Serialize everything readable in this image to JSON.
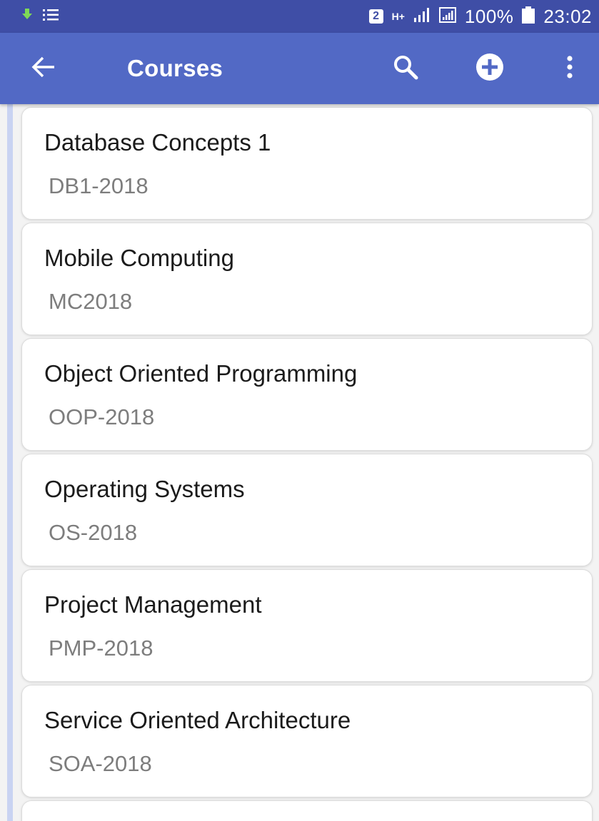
{
  "status_bar": {
    "sim_slot": "2",
    "network_type": "H+",
    "battery_percent": "100%",
    "time": "23:02",
    "icons": [
      "download-icon",
      "notification-list-icon",
      "sim-2-icon",
      "data-hplus-icon",
      "signal-icon",
      "signal-sim2-icon",
      "battery-icon"
    ]
  },
  "app_bar": {
    "title": "Courses",
    "background_color": "#5269c5",
    "icons": [
      "arrow-back-icon",
      "search-icon",
      "add-circle-icon",
      "more-vert-icon"
    ]
  },
  "courses": [
    {
      "name": "Database Concepts 1",
      "code": "DB1-2018"
    },
    {
      "name": "Mobile Computing",
      "code": "MC2018"
    },
    {
      "name": "Object Oriented Programming",
      "code": "OOP-2018"
    },
    {
      "name": "Operating Systems",
      "code": "OS-2018"
    },
    {
      "name": "Project Management",
      "code": "PMP-2018"
    },
    {
      "name": "Service Oriented Architecture",
      "code": "SOA-2018"
    }
  ]
}
